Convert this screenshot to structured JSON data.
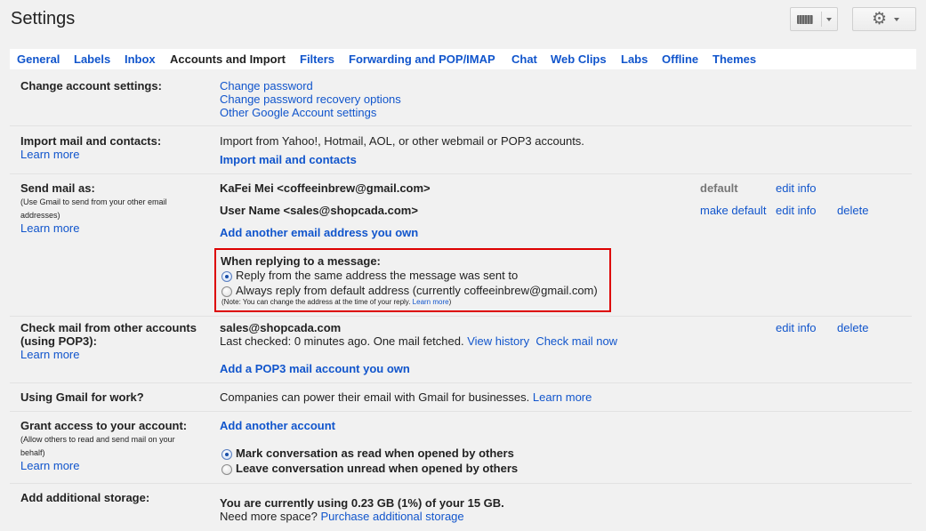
{
  "header": {
    "title": "Settings"
  },
  "tabs": [
    {
      "label": "General"
    },
    {
      "label": "Labels"
    },
    {
      "label": "Inbox"
    },
    {
      "label": "Accounts and Import",
      "active": true
    },
    {
      "label": "Filters"
    },
    {
      "label": "Forwarding and POP/IMAP"
    },
    {
      "label": "Chat"
    },
    {
      "label": "Web Clips"
    },
    {
      "label": "Labs"
    },
    {
      "label": "Offline"
    },
    {
      "label": "Themes"
    }
  ],
  "icons": {
    "keyboard": "keyboard-icon",
    "gear": "gear-icon"
  },
  "colors": {
    "link": "#1155cc",
    "highlight_border": "#dd0000",
    "background": "#f1f1f1"
  },
  "sections": {
    "change_account": {
      "label": "Change account settings:",
      "links": [
        "Change password",
        "Change password recovery options",
        "Other Google Account settings"
      ]
    },
    "import_mail": {
      "label": "Import mail and contacts:",
      "learn_more": "Learn more",
      "description": "Import from Yahoo!, Hotmail, AOL, or other webmail or POP3 accounts.",
      "action": "Import mail and contacts"
    },
    "send_mail": {
      "label": "Send mail as:",
      "note": "(Use Gmail to send from your other email addresses)",
      "learn_more": "Learn more",
      "accounts": [
        {
          "address": "KaFei Mei <coffeeinbrew@gmail.com>",
          "status": "default",
          "edit": "edit info"
        },
        {
          "address": "User Name <sales@shopcada.com>",
          "make_default": "make default",
          "edit": "edit info",
          "delete": "delete"
        }
      ],
      "add": "Add another email address you own",
      "reply": {
        "heading": "When replying to a message:",
        "option_same": "Reply from the same address the message was sent to",
        "option_default": "Always reply from default address (currently coffeeinbrew@gmail.com)",
        "selected": "same",
        "note": "(Note: You can change the address at the time of your reply.",
        "note_link": "Learn more",
        "note_close": ")"
      }
    },
    "check_mail": {
      "label_line1": "Check mail from other accounts",
      "label_line2": "(using POP3):",
      "learn_more": "Learn more",
      "account": "sales@shopcada.com",
      "last_checked": "Last checked: 0 minutes ago. One mail fetched.",
      "view_history": "View history",
      "check_now": "Check mail now",
      "edit": "edit info",
      "delete": "delete",
      "add": "Add a POP3 mail account you own"
    },
    "work": {
      "label": "Using Gmail for work?",
      "description": "Companies can power their email with Gmail for businesses.",
      "learn_more": "Learn more"
    },
    "grant": {
      "label": "Grant access to your account:",
      "note": "(Allow others to read and send mail on your behalf)",
      "learn_more": "Learn more",
      "add": "Add another account",
      "option_read": "Mark conversation as read when opened by others",
      "option_unread": "Leave conversation unread when opened by others",
      "selected": "read"
    },
    "storage": {
      "label": "Add additional storage:",
      "usage": "You are currently using 0.23 GB (1%) of your 15 GB.",
      "need_more": "Need more space?",
      "purchase": "Purchase additional storage"
    }
  }
}
